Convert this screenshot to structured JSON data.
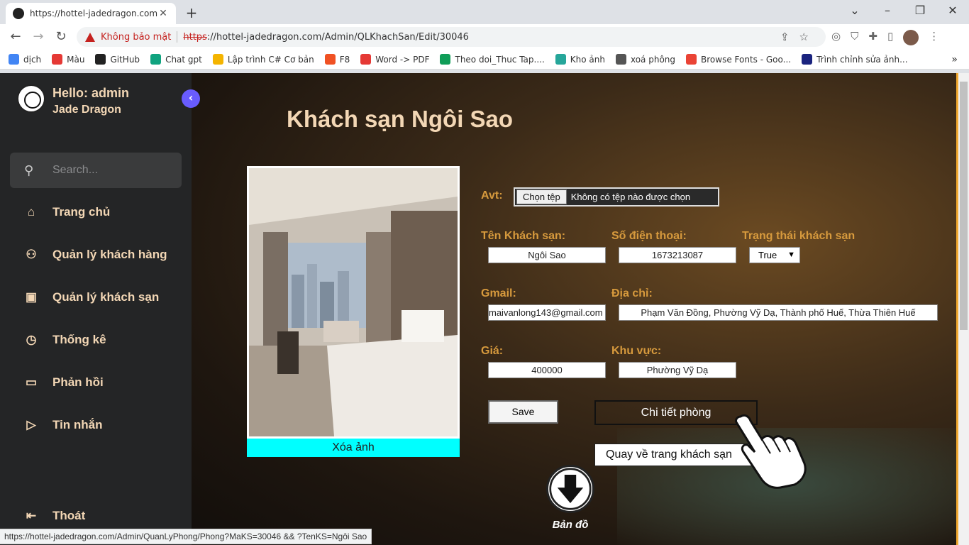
{
  "browser": {
    "tab_title": "https://hottel-jadedragon.com/A",
    "security_label": "Không bảo mật",
    "url_scheme": "https",
    "url_rest": "://hottel-jadedragon.com/Admin/QLKhachSan/Edit/30046",
    "status_url": "https://hottel-jadedragon.com/Admin/QuanLyPhong/Phong?MaKS=30046 && ?TenKS=Ngôi Sao",
    "bookmarks": [
      {
        "label": "dịch",
        "color": "#4285f4"
      },
      {
        "label": "Màu",
        "color": "#e53935"
      },
      {
        "label": "GitHub",
        "color": "#222222"
      },
      {
        "label": "Chat gpt",
        "color": "#10a37f"
      },
      {
        "label": "Lập trình C# Cơ bản",
        "color": "#f4b400"
      },
      {
        "label": "F8",
        "color": "#f05123"
      },
      {
        "label": "Word -> PDF",
        "color": "#e53935"
      },
      {
        "label": "Theo doi_Thuc Tap....",
        "color": "#0f9d58"
      },
      {
        "label": "Kho ảnh",
        "color": "#26a69a"
      },
      {
        "label": "xoá phông",
        "color": "#555555"
      },
      {
        "label": "Browse Fonts - Goo...",
        "color": "#ea4335"
      },
      {
        "label": "Trình chỉnh sửa ảnh...",
        "color": "#1a237e"
      }
    ]
  },
  "sidebar": {
    "greeting": "Hello: admin",
    "brand": "Jade Dragon",
    "search_placeholder": "Search...",
    "items": [
      {
        "label": "Trang chủ",
        "icon": "home-icon"
      },
      {
        "label": "Quản lý khách hàng",
        "icon": "user-x-icon"
      },
      {
        "label": "Quản lý khách sạn",
        "icon": "hotel-icon"
      },
      {
        "label": "Thống kê",
        "icon": "clock-icon"
      },
      {
        "label": "Phản hồi",
        "icon": "chat-icon"
      },
      {
        "label": "Tin nhắn",
        "icon": "send-icon"
      }
    ],
    "logout": "Thoát"
  },
  "form": {
    "title": "Khách sạn Ngôi Sao",
    "delete_photo": "Xóa ảnh",
    "avt_label": "Avt:",
    "file_button": "Chọn tệp",
    "file_status": "Không có tệp nào được chọn",
    "name_label": "Tên Khách sạn:",
    "name_value": "Ngôi Sao",
    "phone_label": "Số điện thoại:",
    "phone_value": "1673213087",
    "status_label": "Trạng thái khách sạn",
    "status_value": "True",
    "email_label": "Gmail:",
    "email_value": "maivanlong143@gmail.com",
    "address_label": "Địa chỉ:",
    "address_value": "Phạm Văn Đồng, Phường Vỹ Dạ, Thành phố Huế, Thừa Thiên Huế",
    "price_label": "Giá:",
    "price_value": "400000",
    "area_label": "Khu vực:",
    "area_value": "Phường Vỹ Dạ",
    "save": "Save",
    "room_detail": "Chi tiết phòng",
    "back": "Quay về trang khách sạn",
    "map": "Bản đồ"
  }
}
